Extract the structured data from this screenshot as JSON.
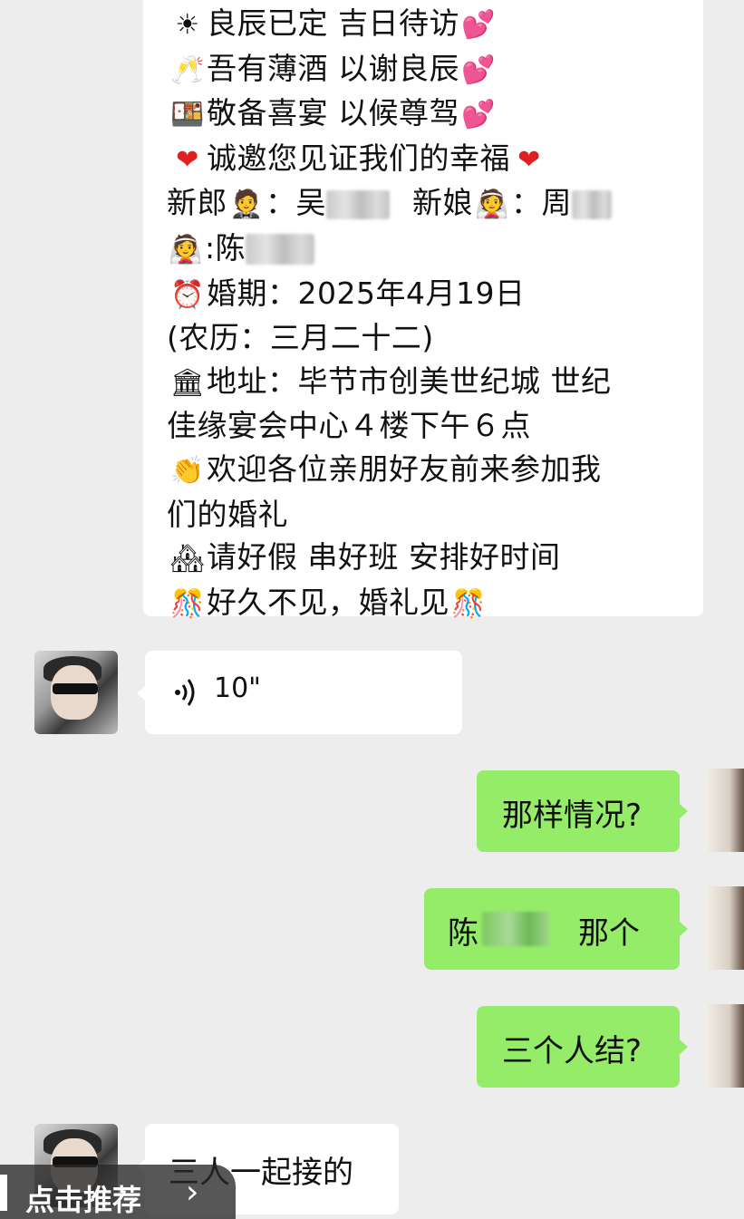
{
  "invitation": {
    "lines": [
      {
        "icon": "☀",
        "text": "良辰已定 吉日待访",
        "trail": "💕"
      },
      {
        "icon": "🥂",
        "text": "吾有薄酒 以谢良辰",
        "trail": "💕"
      },
      {
        "icon": "🍱",
        "text": "敬备喜宴 以候尊驾",
        "trail": "💕"
      },
      {
        "icon": "❤",
        "text": "诚邀您见证我们的幸福",
        "trail": "❤"
      }
    ],
    "groom_label": "新郎",
    "groom_icon": "🤵",
    "groom_sep": "：吴",
    "bride_label": "新娘",
    "bride_icon": "👰",
    "bride_sep": "：周",
    "bride2_icon": "👰",
    "bride2_name": ":陈",
    "date_icon": "⏰",
    "date": "婚期：2025年4月19日",
    "lunar": "(农历：三月二十二)",
    "addr_icon": "🏛",
    "address_1": "地址：毕节市创美世纪城 世纪",
    "address_2": "佳缘宴会中心４楼下午６点",
    "welcome_icon": "👏",
    "welcome_1": "欢迎各位亲朋好友前来参加我",
    "welcome_2": "们的婚礼",
    "leave_icon": "🏘",
    "leave": "请好假 串好班 安排好时间",
    "see_icon": "🎊",
    "see": "好久不见，婚礼见",
    "see_trail": "🎊"
  },
  "voice_message": {
    "duration": "10\""
  },
  "sent": {
    "msg1": "那样情况?",
    "msg2_prefix": "陈",
    "msg2_suffix": "那个",
    "msg3": "三个人结?"
  },
  "received": {
    "msg4": "三人一起接的"
  },
  "footer": {
    "label": "点击推荐",
    "chevron": "›"
  }
}
